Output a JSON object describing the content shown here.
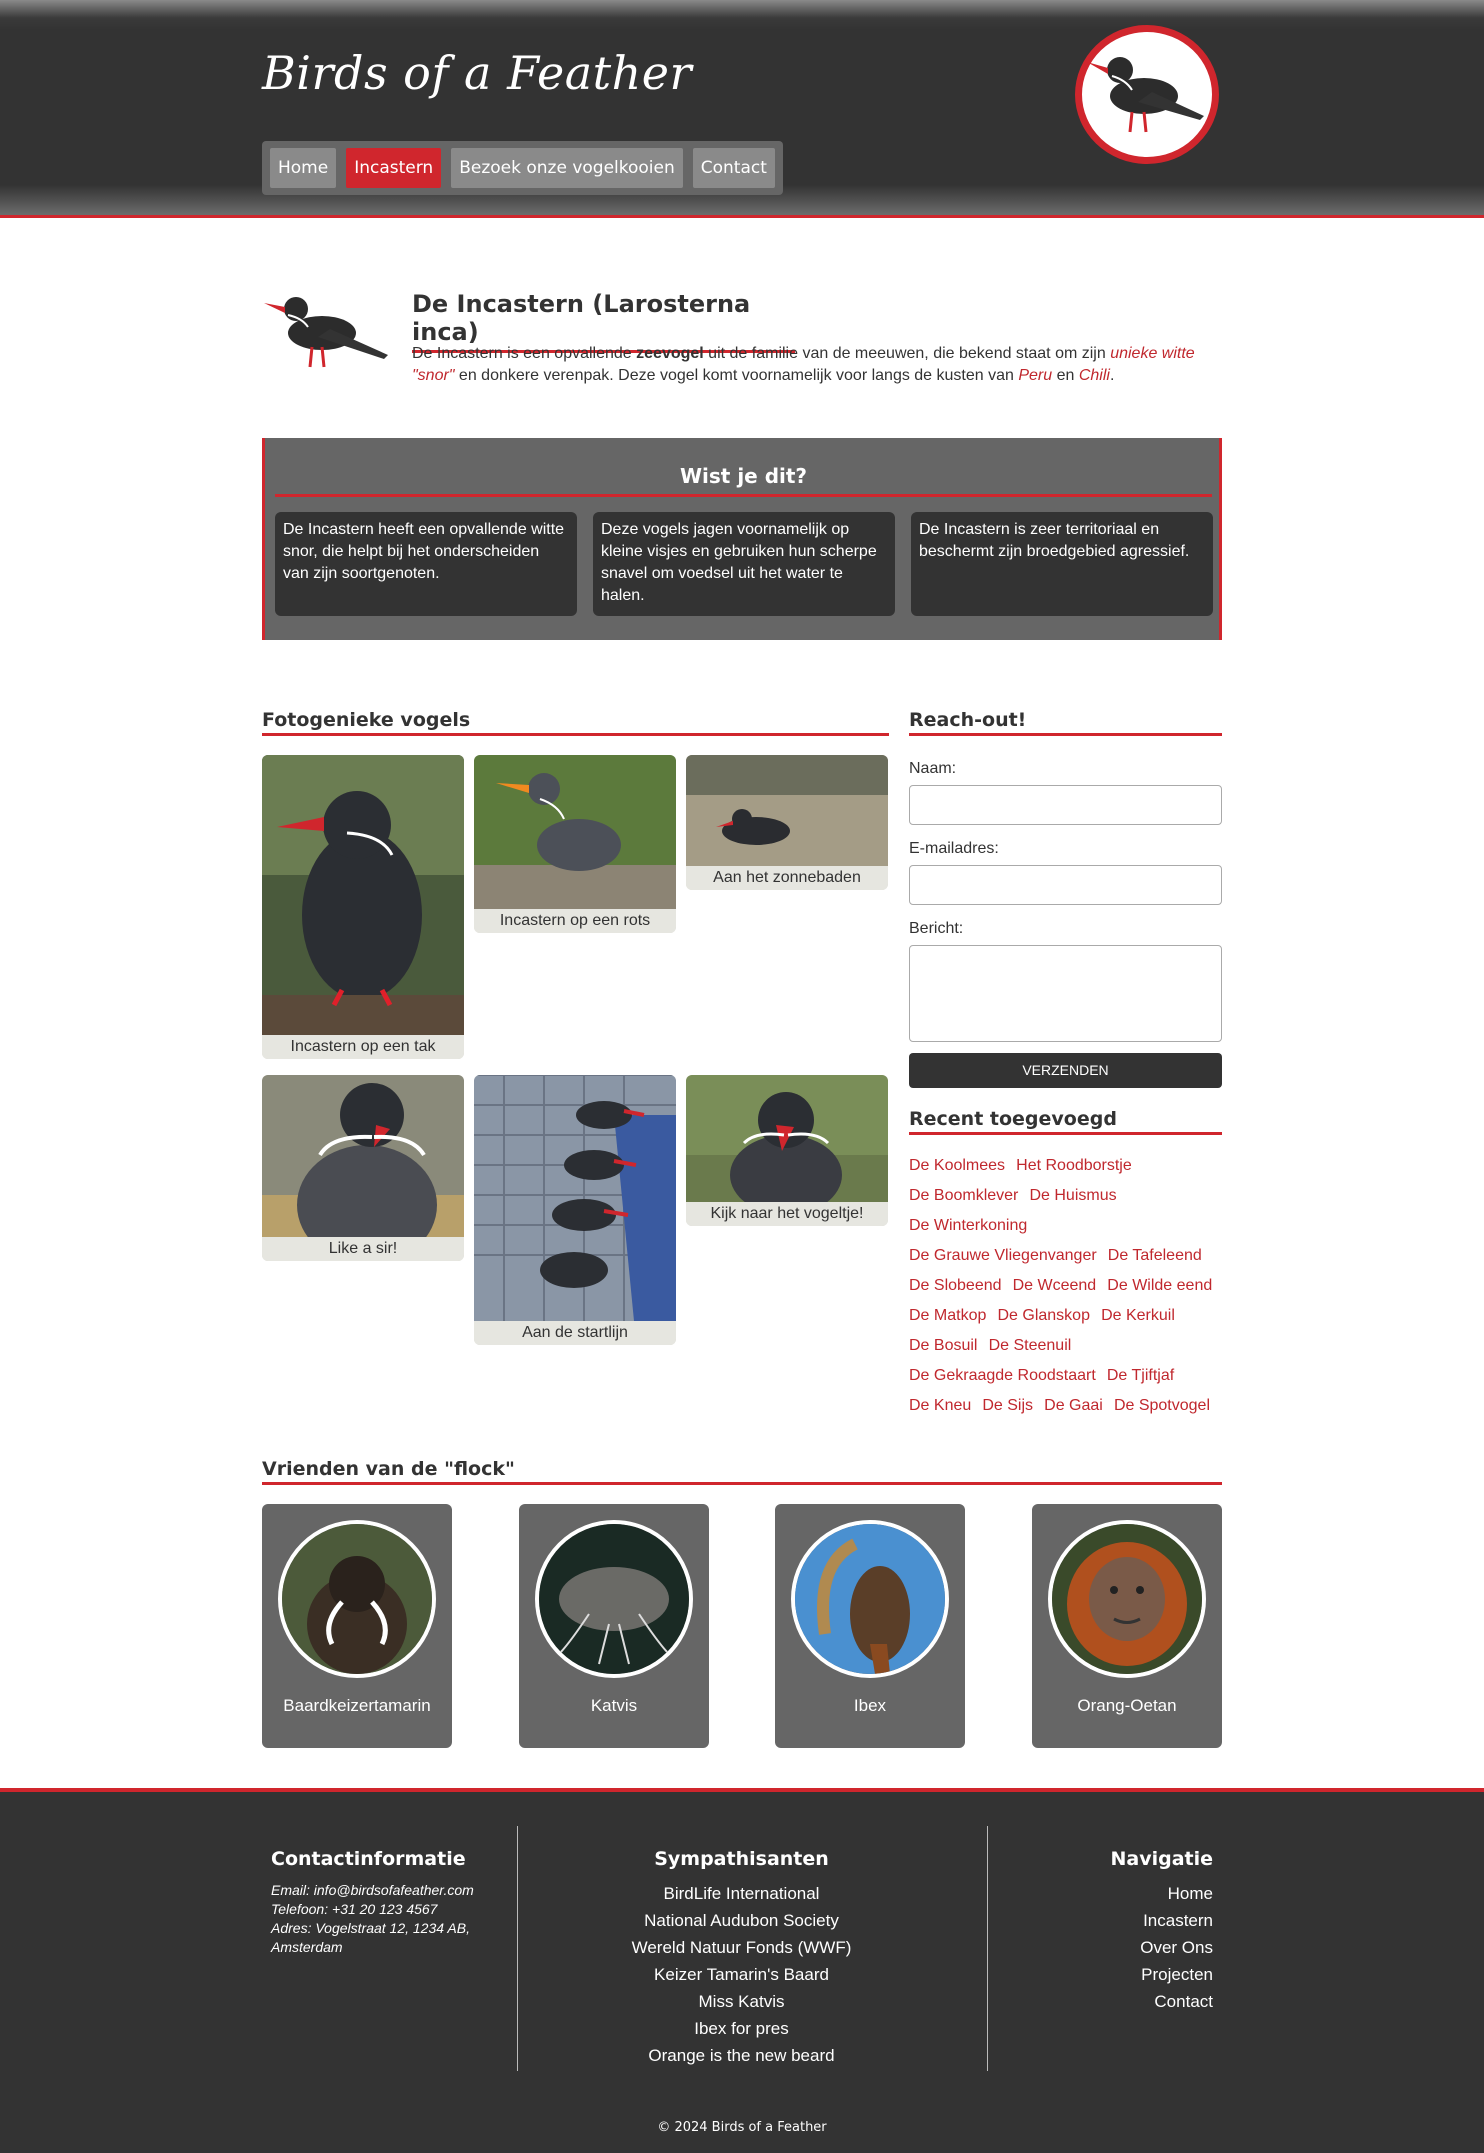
{
  "header": {
    "site_title": "Birds of a Feather",
    "nav": [
      "Home",
      "Incastern",
      "Bezoek onze vogelkooien",
      "Contact"
    ],
    "active_nav": "Incastern"
  },
  "intro": {
    "title": "De Incastern (Larosterna inca)",
    "text_1": "De Incastern is een opvallende ",
    "text_bold": "zeevogel",
    "text_2": " uit de familie van de meeuwen, die bekend staat om zijn ",
    "text_em_1": "unieke witte \"snor\"",
    "text_3": " en donkere verenpak. Deze vogel komt voornamelijk voor langs de kusten van ",
    "text_em_2": "Peru",
    "text_4": " en ",
    "text_em_3": "Chili",
    "text_5": "."
  },
  "facts": {
    "title": "Wist je dit?",
    "items": [
      "De Incastern heeft een opvallende witte snor, die helpt bij het onderscheiden van zijn soortgenoten.",
      "Deze vogels jagen voornamelijk op kleine visjes en gebruiken hun scherpe snavel om voedsel uit het water te halen.",
      "De Incastern is zeer territoriaal en beschermt zijn broedgebied agressief."
    ]
  },
  "gallery": {
    "title": "Fotogenieke vogels",
    "captions": [
      "Incastern op een tak",
      "Incastern op een rots",
      "Aan het zonnebaden",
      "Like a sir!",
      "Aan de startlijn",
      "Kijk naar het vogeltje!"
    ]
  },
  "form": {
    "title": "Reach-out!",
    "name_label": "Naam:",
    "email_label": "E-mailadres:",
    "message_label": "Bericht:",
    "submit_label": "VERZENDEN"
  },
  "recent": {
    "title": "Recent toegevoegd",
    "rows": [
      [
        "De Koolmees",
        "Het Roodborstje"
      ],
      [
        "De Boomklever",
        "De Huismus"
      ],
      [
        "De Winterkoning"
      ],
      [
        "De Grauwe Vliegenvanger",
        "De Tafeleend"
      ],
      [
        "De Slobeend",
        "De Wceend",
        "De Wilde eend"
      ],
      [
        "De Matkop",
        "De Glanskop",
        "De Kerkuil"
      ],
      [
        "De Bosuil",
        "De Steenuil"
      ],
      [
        "De Gekraagde Roodstaart",
        "De Tjiftjaf"
      ],
      [
        "De Kneu",
        "De Sijs",
        "De Gaai",
        "De Spotvogel"
      ]
    ]
  },
  "friends": {
    "title": "Vrienden van de \"flock\"",
    "items": [
      "Baardkeizertamarin",
      "Katvis",
      "Ibex",
      "Orang-Oetan"
    ]
  },
  "footer": {
    "contact_title": "Contactinformatie",
    "contact_lines": [
      "Email: info@birdsofafeather.com",
      "Telefoon: +31 20 123 4567",
      "Adres: Vogelstraat 12, 1234 AB, Amsterdam"
    ],
    "sponsors_title": "Sympathisanten",
    "sponsors": [
      "BirdLife International",
      "National Audubon Society",
      "Wereld Natuur Fonds (WWF)",
      "Keizer Tamarin's Baard",
      "Miss Katvis",
      "Ibex for pres",
      "Orange is the new beard"
    ],
    "nav_title": "Navigatie",
    "nav": [
      "Home",
      "Incastern",
      "Over Ons",
      "Projecten",
      "Contact"
    ],
    "copyright": "© 2024 Birds of a Feather"
  },
  "colors": {
    "accent": "#d0262d",
    "dark": "#333333",
    "panel": "#666666"
  }
}
